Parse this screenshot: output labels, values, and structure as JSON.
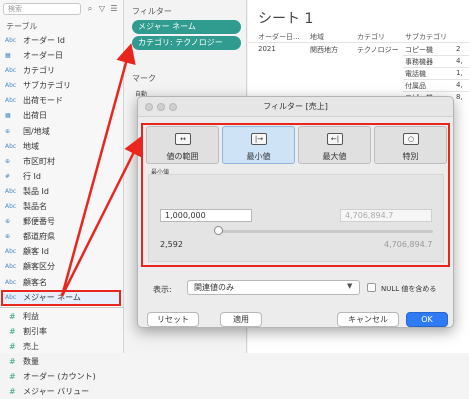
{
  "data_pane": {
    "search_placeholder": "検索",
    "section_title": "テーブル",
    "fields": [
      {
        "type": "Abc",
        "name": "オーダー Id"
      },
      {
        "type": "cal",
        "name": "オーダー日"
      },
      {
        "type": "Abc",
        "name": "カテゴリ"
      },
      {
        "type": "Abc",
        "name": "サブカテゴリ"
      },
      {
        "type": "Abc",
        "name": "出荷モード"
      },
      {
        "type": "cal",
        "name": "出荷日"
      },
      {
        "type": "globe",
        "name": "国/地域"
      },
      {
        "type": "Abc",
        "name": "地域"
      },
      {
        "type": "globe",
        "name": "市区町村"
      },
      {
        "type": "#",
        "name": "行 Id"
      },
      {
        "type": "Abc",
        "name": "製品 Id"
      },
      {
        "type": "Abc",
        "name": "製品名"
      },
      {
        "type": "globe",
        "name": "郵便番号"
      },
      {
        "type": "globe",
        "name": "都道府県"
      },
      {
        "type": "Abc",
        "name": "顧客 Id"
      },
      {
        "type": "Abc",
        "name": "顧客区分"
      },
      {
        "type": "Abc",
        "name": "顧客名"
      },
      {
        "type": "Abc",
        "name": "メジャー ネーム"
      },
      {
        "type": "num",
        "name": "利益"
      },
      {
        "type": "num",
        "name": "割引率"
      },
      {
        "type": "num",
        "name": "売上"
      },
      {
        "type": "num",
        "name": "数量"
      },
      {
        "type": "num",
        "name": "オーダー (カウント)"
      },
      {
        "type": "num",
        "name": "メジャー バリュー"
      }
    ]
  },
  "shelves": {
    "filters_title": "フィルター",
    "filter_pills": [
      "メジャー ネーム",
      "カテゴリ: テクノロジー"
    ],
    "marks_title": "マーク",
    "marks_type": "自動"
  },
  "sheet": {
    "title": "シート 1",
    "headers": [
      "オーダー日...",
      "地域",
      "カテゴリ",
      "サブカテゴリ"
    ],
    "year": "2021",
    "region": "関西地方",
    "category": "テクノロジー",
    "subcategories": [
      "コピー機",
      "事務機器",
      "電話機",
      "付属品",
      "コピー機"
    ],
    "value_fragments": [
      "2",
      "4,",
      "1,",
      "4,",
      "8,"
    ]
  },
  "dialog": {
    "title": "フィルター [売上]",
    "tabs": [
      {
        "label": "値の範囲",
        "icon": "range-icon"
      },
      {
        "label": "最小値",
        "icon": "at-least-icon"
      },
      {
        "label": "最大値",
        "icon": "at-most-icon"
      },
      {
        "label": "特別",
        "icon": "special-icon"
      }
    ],
    "selected_tab": "最小値",
    "min_section_label": "最小値",
    "min_value": "1,000,000",
    "max_value_placeholder": "4,706,894.7",
    "range_min": "2,592",
    "range_max": "4,706,894.7",
    "show_label": "表示:",
    "show_option": "関連値のみ",
    "null_label": "NULL 値を含める",
    "buttons": {
      "reset": "リセット",
      "apply": "適用",
      "cancel": "キャンセル",
      "ok": "OK"
    }
  },
  "colors": {
    "annotation": "#e8261e",
    "pill": "#2f9c8f",
    "ok": "#2f7bf5"
  }
}
